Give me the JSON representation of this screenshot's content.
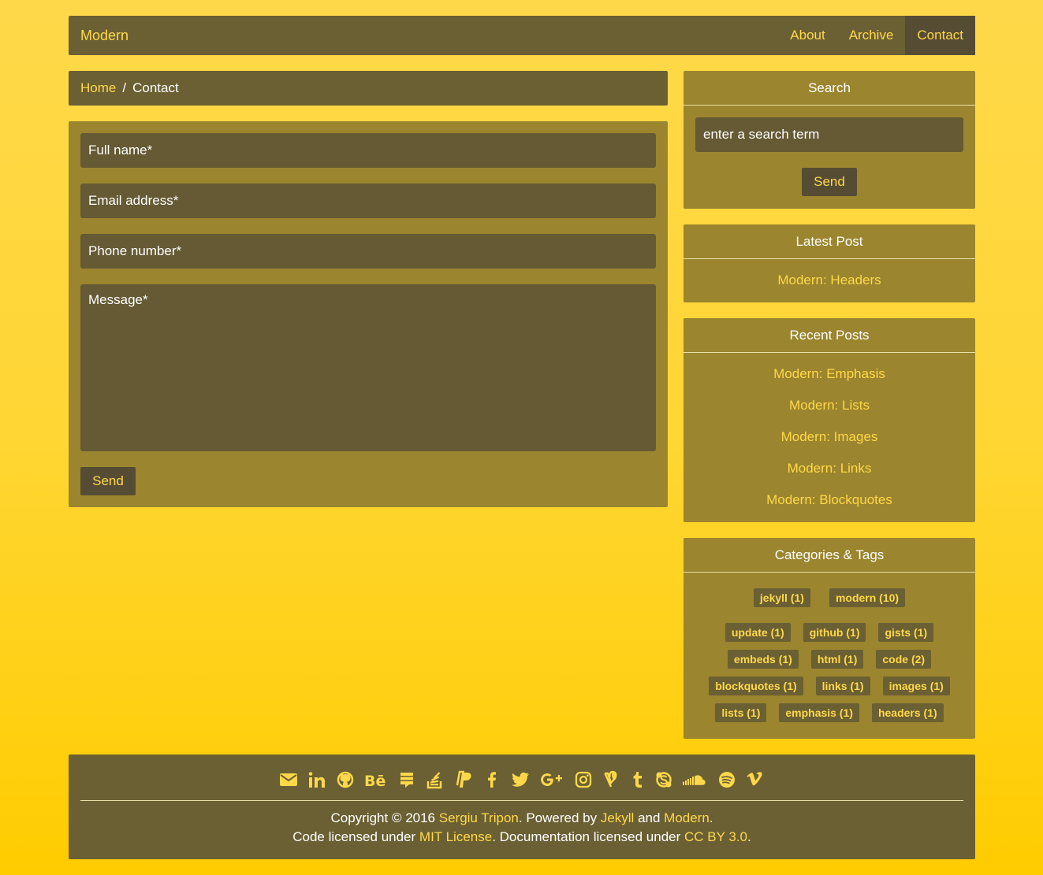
{
  "nav": {
    "brand": "Modern",
    "items": [
      {
        "label": "About"
      },
      {
        "label": "Archive"
      },
      {
        "label": "Contact",
        "active": true
      }
    ]
  },
  "breadcrumb": {
    "home": "Home",
    "separator": "/",
    "current": "Contact"
  },
  "contact_form": {
    "full_name_placeholder": "Full name*",
    "email_placeholder": "Email address*",
    "phone_placeholder": "Phone number*",
    "message_placeholder": "Message*",
    "send_label": "Send"
  },
  "sidebar": {
    "search": {
      "title": "Search",
      "placeholder": "enter a search term",
      "send_label": "Send"
    },
    "latest_post": {
      "title": "Latest Post",
      "post": "Modern: Headers"
    },
    "recent_posts": {
      "title": "Recent Posts",
      "items": [
        "Modern: Emphasis",
        "Modern: Lists",
        "Modern: Images",
        "Modern: Links",
        "Modern: Blockquotes"
      ]
    },
    "categories_tags": {
      "title": "Categories & Tags",
      "categories": [
        "jekyll (1)",
        "modern (10)"
      ],
      "tag_rows": [
        [
          "update (1)",
          "github (1)",
          "gists (1)"
        ],
        [
          "embeds (1)",
          "html (1)",
          "code (2)"
        ],
        [
          "blockquotes (1)",
          "links (1)",
          "images (1)"
        ],
        [
          "lists (1)",
          "emphasis (1)",
          "headers (1)"
        ]
      ]
    }
  },
  "footer": {
    "social_icons": [
      "envelope-icon",
      "linkedin-icon",
      "github-icon",
      "behance-icon",
      "stackexchange-icon",
      "stackoverflow-icon",
      "paypal-icon",
      "facebook-icon",
      "twitter-icon",
      "google-plus-icon",
      "instagram-icon",
      "vine-icon",
      "tumblr-icon",
      "skype-icon",
      "soundcloud-icon",
      "spotify-icon",
      "vimeo-icon"
    ],
    "line1": {
      "prefix": "Copyright © 2016 ",
      "author": "Sergiu Tripon",
      "mid1": ". Powered by ",
      "jekyll": "Jekyll",
      "and": " and ",
      "modern": "Modern",
      "end": "."
    },
    "line2": {
      "prefix": "Code licensed under ",
      "mit": "MIT License",
      "mid": ". Documentation licensed under ",
      "cc": "CC BY 3.0",
      "end": "."
    }
  },
  "colors": {
    "accent": "#ffd84a",
    "panel": "#9b852e",
    "dark": "#6b6033"
  }
}
